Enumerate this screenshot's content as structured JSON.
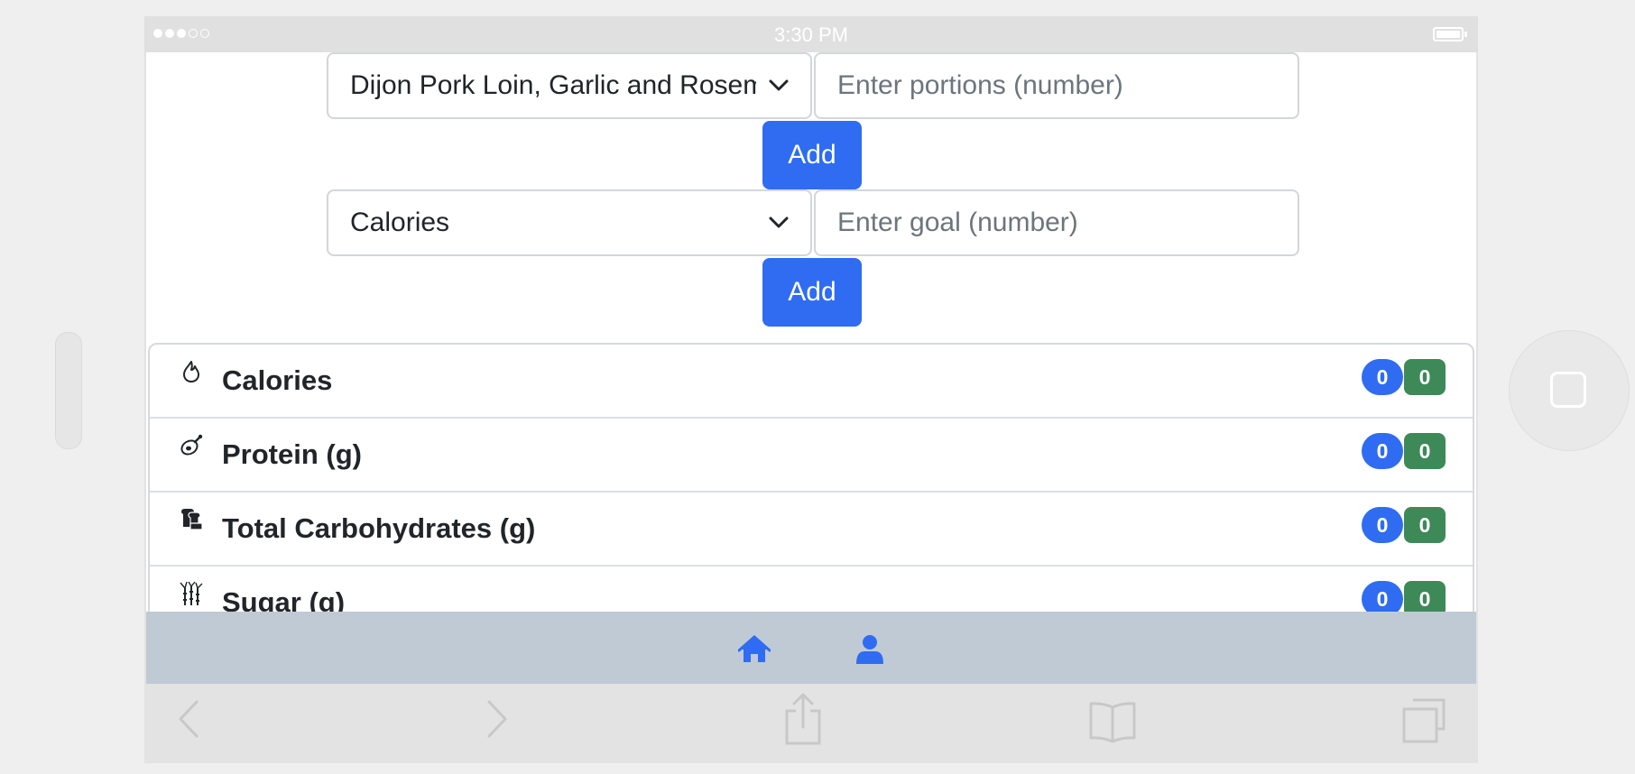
{
  "status_bar": {
    "time": "3:30 PM"
  },
  "recipe_form": {
    "selected_recipe": "Dijon Pork Loin, Garlic and Rosemary Potatoes",
    "portions_placeholder": "Enter portions (number)",
    "add_label": "Add"
  },
  "goal_form": {
    "selected_nutrient": "Calories",
    "goal_placeholder": "Enter goal (number)",
    "add_label": "Add"
  },
  "nutrients": [
    {
      "label": "Calories",
      "icon": "fire-icon",
      "consumed": "0",
      "goal": "0"
    },
    {
      "label": "Protein (g)",
      "icon": "meat-icon",
      "consumed": "0",
      "goal": "0"
    },
    {
      "label": "Total Carbohydrates (g)",
      "icon": "bread-icon",
      "consumed": "0",
      "goal": "0"
    },
    {
      "label": "Sugar (g)",
      "icon": "sugarcane-icon",
      "consumed": "0",
      "goal": "0"
    }
  ],
  "bottom_nav": {
    "items": [
      "home-icon",
      "user-icon"
    ]
  },
  "browser_toolbar": {
    "items": [
      "back-icon",
      "forward-icon",
      "share-icon",
      "bookmarks-icon",
      "tabs-icon"
    ]
  },
  "colors": {
    "primary": "#2f6cf2",
    "success": "#3e8958",
    "nav_background": "#c0cad5"
  }
}
